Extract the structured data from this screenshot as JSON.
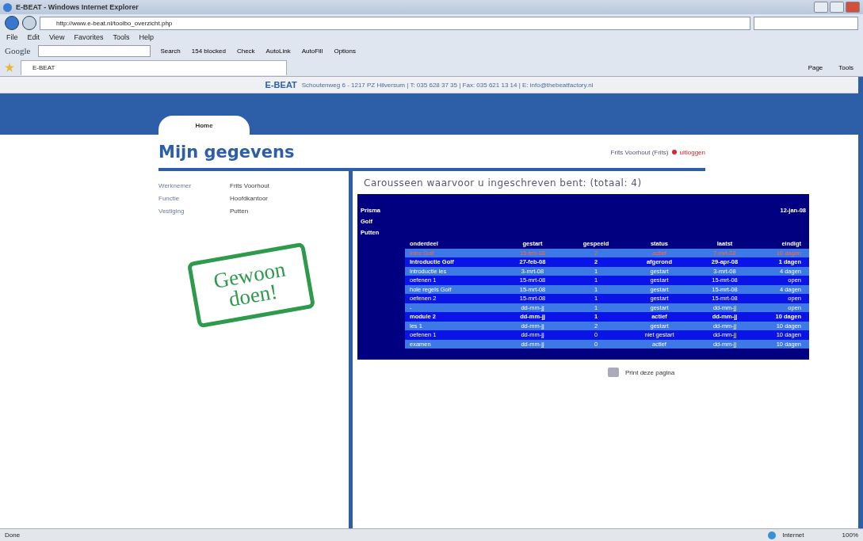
{
  "window": {
    "title": "E-BEAT - Windows Internet Explorer"
  },
  "address_bar": {
    "url": "http://www.e-beat.nl/toolbo_overzicht.php"
  },
  "menu": [
    "File",
    "Edit",
    "View",
    "Favorites",
    "Tools",
    "Help"
  ],
  "google_toolbar": {
    "label": "Google",
    "buttons": [
      "Search",
      "154 blocked",
      "Check",
      "AutoLink",
      "AutoFill",
      "Options"
    ]
  },
  "browser_tab": {
    "label": "E-BEAT"
  },
  "command_bar": [
    "Page",
    "Tools"
  ],
  "site": {
    "logo": "E-BEAT",
    "contact": "Schoutenweg 6 - 1217 PZ Hilversum | T: 035 628 37 35 | Fax: 035 621 13 14 | E: info@thebeatfactory.nl",
    "tabs": [
      {
        "label": "Home",
        "selected": true
      }
    ],
    "heading": "Mijn gegevens",
    "user": "Frits Voorhout (Frits)",
    "logout": "uitloggen",
    "details": [
      {
        "label": "Werknemer",
        "value": "Frits Voorhout"
      },
      {
        "label": "Functie",
        "value": "Hoofdkantoor"
      },
      {
        "label": "Vestiging",
        "value": "Putten"
      }
    ],
    "stamp": [
      "Gewoon",
      "doen!"
    ],
    "section_title": "Carousseen waarvoor u ingeschreven bent: (totaal: 4)",
    "table_header": {
      "lines": [
        "Prisma",
        "Golf",
        "Putten"
      ],
      "date": "12-jan-08"
    },
    "columns": [
      "onderdeel",
      "gestart",
      "gespeeld",
      "status",
      "laatst",
      "eindigt"
    ],
    "rows": [
      {
        "kind": "highlight",
        "cells": [
          "Intro Golf",
          "15-feb-08",
          "2",
          "actief",
          "7-mrt-08",
          "10 dagen"
        ]
      },
      {
        "kind": "course",
        "cells": [
          "Introductie Golf",
          "27-feb-08",
          "2",
          "afgerond",
          "29-apr-08",
          "1 dagen"
        ]
      },
      {
        "kind": "part",
        "cells": [
          "introductie les",
          "3-mrt-08",
          "1",
          "gestart",
          "3-mrt-08",
          "4 dagen"
        ]
      },
      {
        "kind": "part",
        "cells": [
          "oefenen 1",
          "15-mrt-08",
          "1",
          "gestart",
          "15-mrt-08",
          "open"
        ]
      },
      {
        "kind": "part",
        "cells": [
          "hole regels Golf",
          "15-mrt-08",
          "1",
          "gestart",
          "15-mrt-08",
          "4 dagen"
        ]
      },
      {
        "kind": "part",
        "cells": [
          "oefenen 2",
          "15-mrt-08",
          "1",
          "gestart",
          "15-mrt-08",
          "open"
        ]
      },
      {
        "kind": "part",
        "cells": [
          "-",
          "dd-mm-jj",
          "1",
          "gestart",
          "dd-mm-jj",
          "open"
        ]
      },
      {
        "kind": "course",
        "cells": [
          "module 2",
          "dd-mm-jj",
          "1",
          "actief",
          "dd-mm-jj",
          "10 dagen"
        ]
      },
      {
        "kind": "part",
        "cells": [
          "les 1",
          "dd-mm-jj",
          "2",
          "gestart",
          "dd-mm-jj",
          "10 dagen"
        ]
      },
      {
        "kind": "part",
        "cells": [
          "oefenen 1",
          "dd-mm-jj",
          "0",
          "niet gestart",
          "dd-mm-jj",
          "10 dagen"
        ]
      },
      {
        "kind": "part",
        "cells": [
          "examen",
          "dd-mm-jj",
          "0",
          "actief",
          "dd-mm-jj",
          "10 dagen"
        ]
      }
    ],
    "print": "Print deze pagina"
  },
  "status_bar": {
    "text": "Done",
    "zone": "Internet",
    "zoom": "100%"
  }
}
